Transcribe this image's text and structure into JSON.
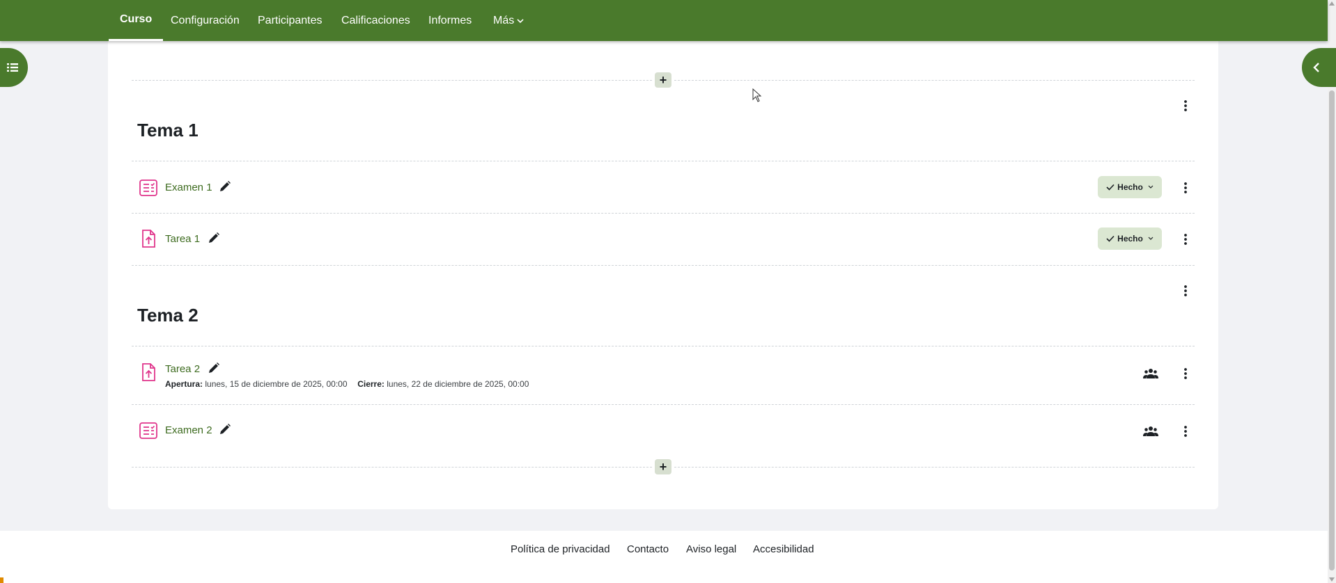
{
  "nav": {
    "tabs": [
      {
        "label": "Curso",
        "active": true
      },
      {
        "label": "Configuración"
      },
      {
        "label": "Participantes"
      },
      {
        "label": "Calificaciones"
      },
      {
        "label": "Informes"
      },
      {
        "label": "Más"
      }
    ]
  },
  "sections": [
    {
      "title": "Tema 1",
      "activities": [
        {
          "name": "Examen 1",
          "type": "quiz-icon",
          "completion": "Hecho"
        },
        {
          "name": "Tarea 1",
          "type": "assignment-icon",
          "completion": "Hecho"
        }
      ]
    },
    {
      "title": "Tema 2",
      "activities": [
        {
          "name": "Tarea 2",
          "type": "assignment-icon",
          "opening_label": "Apertura:",
          "opening_value": "lunes, 15 de diciembre de 2025, 00:00",
          "closing_label": "Cierre:",
          "closing_value": "lunes, 22 de diciembre de 2025, 00:00"
        },
        {
          "name": "Examen 2",
          "type": "quiz-icon"
        }
      ]
    }
  ],
  "add_symbol": "+",
  "footer": {
    "links": [
      "Política de privacidad",
      "Contacto",
      "Aviso legal",
      "Accesibilidad"
    ]
  },
  "colors": {
    "brand": "#4a7a2c",
    "link": "#3d6b1f",
    "activity_icon": "#e0368c",
    "done_bg": "#dbe7d2"
  }
}
